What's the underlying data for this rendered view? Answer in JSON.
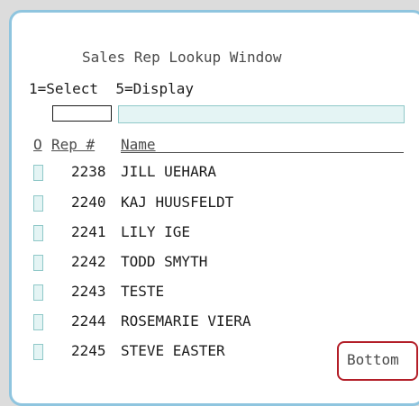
{
  "window": {
    "title": "Sales Rep Lookup Window",
    "options": "1=Select  5=Display"
  },
  "columns": {
    "option": "O",
    "rep_number": "Rep #",
    "name": "Name"
  },
  "rows": [
    {
      "rep": "2238",
      "name": "JILL UEHARA"
    },
    {
      "rep": "2240",
      "name": "KAJ HUUSFELDT"
    },
    {
      "rep": "2241",
      "name": "LILY IGE"
    },
    {
      "rep": "2242",
      "name": "TODD SMYTH"
    },
    {
      "rep": "2243",
      "name": "TESTE"
    },
    {
      "rep": "2244",
      "name": "ROSEMARIE VIERA"
    },
    {
      "rep": "2245",
      "name": "STEVE EASTER"
    }
  ],
  "footer": {
    "more_indicator": "Bottom"
  },
  "colors": {
    "window_border": "#8fc5df",
    "input_fill": "#e4f4f4",
    "highlight_box": "#b31e28"
  }
}
